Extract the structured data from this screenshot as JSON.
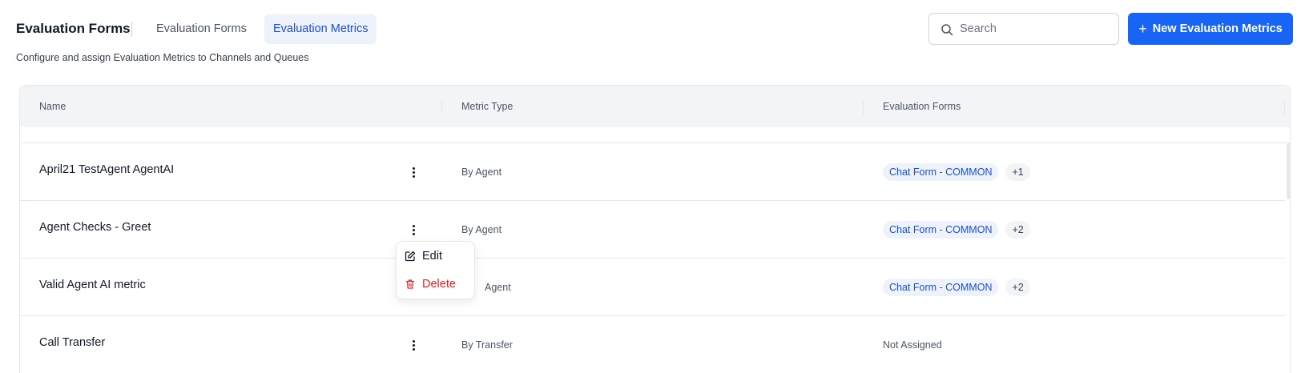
{
  "header": {
    "title": "Evaluation Forms",
    "tabs": [
      {
        "label": "Evaluation Forms",
        "active": false
      },
      {
        "label": "Evaluation Metrics",
        "active": true
      }
    ],
    "subtitle": "Configure and assign Evaluation Metrics to Channels and Queues",
    "search_placeholder": "Search",
    "new_button_label": "New Evaluation Metrics",
    "accent_color": "#1764f5"
  },
  "table": {
    "columns": [
      "Name",
      "Metric Type",
      "Evaluation Forms"
    ],
    "rows": [
      {
        "name": "April21 TestAgent AgentAI",
        "type": "By Agent",
        "forms": [
          "Chat Form - COMMON"
        ],
        "more": "+1",
        "status": ""
      },
      {
        "name": "Agent Checks - Greet",
        "type": "By Agent",
        "forms": [
          "Chat Form - COMMON"
        ],
        "more": "+2",
        "status": ""
      },
      {
        "name": "Valid Agent AI metric",
        "type": "Agent",
        "forms": [
          "Chat Form - COMMON"
        ],
        "more": "+2",
        "status": ""
      },
      {
        "name": "Call Transfer",
        "type": "By Transfer",
        "forms": [],
        "more": "",
        "status": "Not Assigned"
      }
    ]
  },
  "context_menu": {
    "edit_label": "Edit",
    "delete_label": "Delete",
    "delete_color": "#dc2626"
  }
}
